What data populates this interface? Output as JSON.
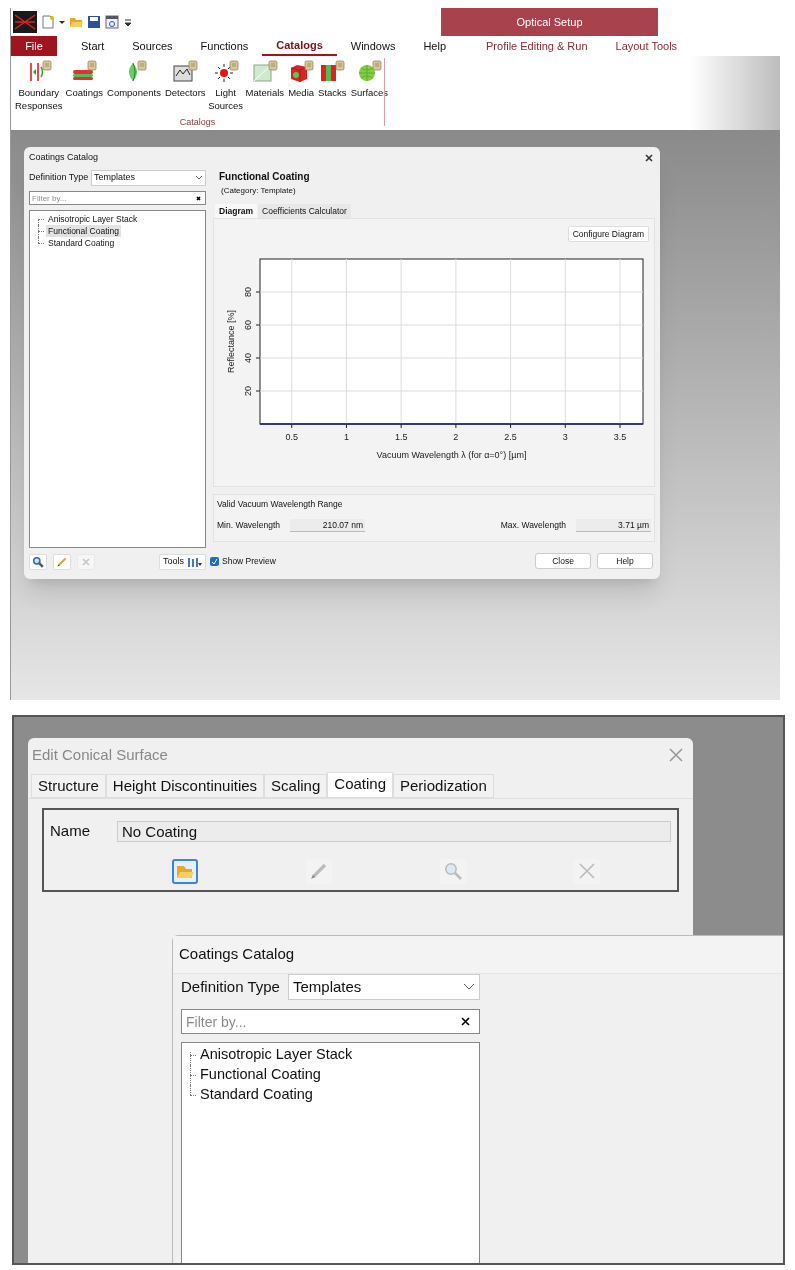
{
  "app_window": {
    "context_group": "Optical Setup",
    "menu_tabs": [
      {
        "label": "File",
        "kind": "file",
        "selected": false
      },
      {
        "label": "Start",
        "kind": "normal",
        "selected": false
      },
      {
        "label": "Sources",
        "kind": "normal",
        "selected": false
      },
      {
        "label": "Functions",
        "kind": "normal",
        "selected": false
      },
      {
        "label": "Catalogs",
        "kind": "normal",
        "selected": true
      },
      {
        "label": "Windows",
        "kind": "normal",
        "selected": false
      },
      {
        "label": "Help",
        "kind": "normal",
        "selected": false
      },
      {
        "label": "Profile Editing & Run",
        "kind": "contextual",
        "selected": false
      },
      {
        "label": "Layout Tools",
        "kind": "contextual",
        "selected": false
      }
    ],
    "ribbon_group": {
      "label": "Catalogs",
      "buttons": [
        {
          "label": "Boundary Responses",
          "kind": "boundary"
        },
        {
          "label": "Coatings",
          "kind": "coatings"
        },
        {
          "label": "Components",
          "kind": "components"
        },
        {
          "label": "Detectors",
          "kind": "detectors"
        },
        {
          "label": "Light Sources",
          "kind": "light"
        },
        {
          "label": "Materials",
          "kind": "materials"
        },
        {
          "label": "Media",
          "kind": "media"
        },
        {
          "label": "Stacks",
          "kind": "stacks"
        },
        {
          "label": "Surfaces",
          "kind": "surfaces"
        }
      ]
    }
  },
  "catalog_dialog": {
    "title": "Coatings Catalog",
    "definition_type_label": "Definition Type",
    "definition_type_value": "Templates",
    "filter_placeholder": "Filter by...",
    "tree": [
      {
        "label": "Anisotropic Layer Stack",
        "selected": false
      },
      {
        "label": "Functional Coating",
        "selected": true
      },
      {
        "label": "Standard Coating",
        "selected": false
      }
    ],
    "tool_buttons": [
      {
        "kind": "search",
        "disabled": false
      },
      {
        "kind": "edit",
        "disabled": false
      },
      {
        "kind": "delete",
        "disabled": true
      }
    ],
    "tools_button": "Tools",
    "show_preview": {
      "label": "Show Preview",
      "checked": true
    },
    "heading": "Functional Coating",
    "category": "(Category: Template)",
    "tabs": [
      {
        "label": "Diagram",
        "selected": true
      },
      {
        "label": "Coefficients Calculator",
        "selected": false
      }
    ],
    "configure_button": "Configure Diagram",
    "chart_data": {
      "type": "line",
      "xlabel": "Vacuum Wavelength λ (for α=0°) [µm]",
      "ylabel": "Reflectance [%]",
      "x": [
        0.21,
        3.71
      ],
      "series": [
        {
          "color": "#1c1c7a",
          "values": [
            0,
            0
          ]
        }
      ],
      "grid": true,
      "xlim": [
        0.21,
        3.71
      ],
      "ylim": [
        0,
        100
      ],
      "xticks": [
        0.5,
        1,
        1.5,
        2,
        2.5,
        3,
        3.5
      ],
      "yticks": [
        20,
        40,
        60,
        80
      ]
    },
    "range_group": {
      "title": "Valid Vacuum Wavelength Range",
      "fields": [
        {
          "label": "Min. Wavelength",
          "value": "210.07 nm"
        },
        {
          "label": "Max. Wavelength",
          "value": "3.71 µm"
        }
      ]
    },
    "buttons": [
      "Close",
      "Help"
    ]
  },
  "edit_dialog": {
    "title": "Edit Conical Surface",
    "tabs": [
      {
        "label": "Structure",
        "selected": false
      },
      {
        "label": "Height Discontinuities",
        "selected": false
      },
      {
        "label": "Scaling",
        "selected": false
      },
      {
        "label": "Coating",
        "selected": true
      },
      {
        "label": "Periodization",
        "selected": false
      }
    ],
    "name_label": "Name",
    "name_value": "No Coating",
    "icon_buttons": [
      {
        "kind": "open",
        "disabled": false
      },
      {
        "kind": "edit",
        "disabled": true
      },
      {
        "kind": "search",
        "disabled": true
      },
      {
        "kind": "delete",
        "disabled": true
      }
    ]
  },
  "catalog_dialog_2": {
    "title": "Coatings Catalog",
    "definition_type_label": "Definition Type",
    "definition_type_value": "Templates",
    "filter_placeholder": "Filter by...",
    "tree": [
      {
        "label": "Anisotropic Layer Stack",
        "selected": false
      },
      {
        "label": "Functional Coating",
        "selected": false
      },
      {
        "label": "Standard Coating",
        "selected": false
      }
    ]
  }
}
